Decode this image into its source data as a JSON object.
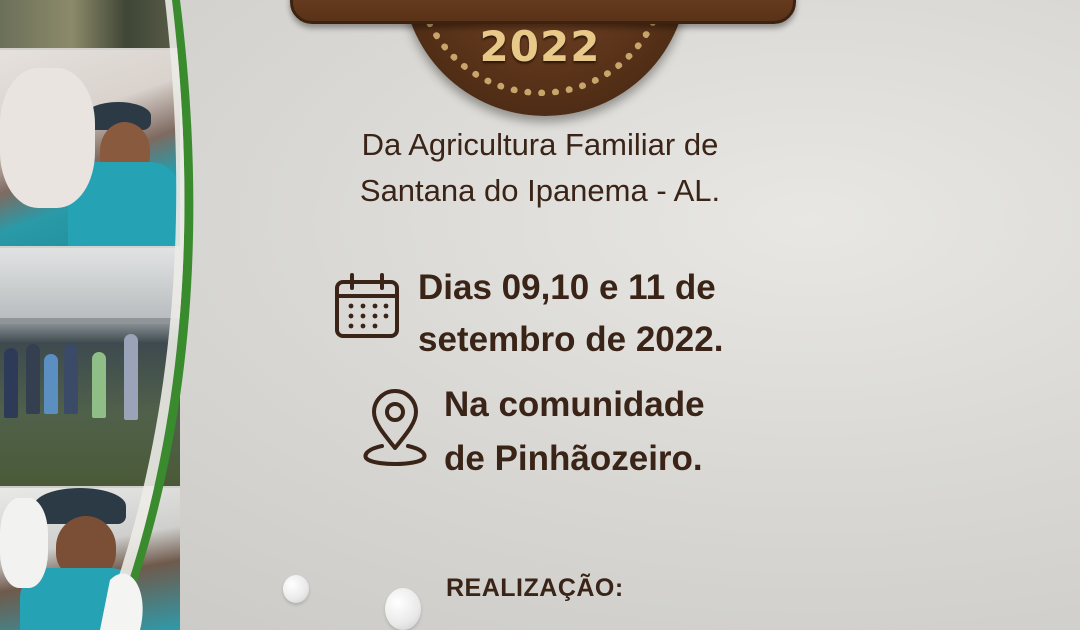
{
  "poster": {
    "year": "2022",
    "subtitle_line1": "Da Agricultura Familiar de",
    "subtitle_line2": "Santana do Ipanema - AL.",
    "dates_line1": "Dias 09,10 e 11 de",
    "dates_line2": "setembro de 2022.",
    "location_line1": "Na comunidade",
    "location_line2": "de Pinhãozeiro.",
    "realizacao": "REALIZAÇÃO:"
  },
  "icons": {
    "calendar": "calendar-icon",
    "location": "location-pin-icon"
  },
  "colors": {
    "text": "#3a2418",
    "wood": "#5a3319",
    "rope": "#c9a56b",
    "accent_green": "#3a8a2e",
    "background": "#d9d8d4"
  }
}
